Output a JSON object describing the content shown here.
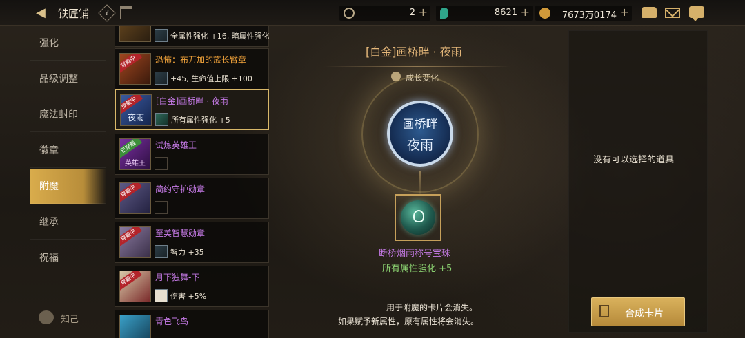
{
  "header": {
    "back_arrow": "chevron-left-icon",
    "title": "铁匠铺",
    "help_glyph": "?",
    "calendar_glyph": "",
    "currencies": [
      {
        "name": "cera-coin-icon",
        "value": "2",
        "plus": "+"
      },
      {
        "name": "green-gem-icon",
        "value": "8621",
        "plus": "+"
      },
      {
        "name": "gold-coin-icon",
        "value": "7673万0174",
        "plus": "+"
      }
    ]
  },
  "menu": {
    "items": [
      "强化",
      "品级调整",
      "魔法封印",
      "徽章",
      "附魔",
      "继承",
      "祝福"
    ],
    "active_index": 4,
    "bottom_label": "知己"
  },
  "items": [
    {
      "name": "",
      "attr": "全属性强化 +16, 暗属性强化"
    },
    {
      "name": "恐怖：布万加的族长臂章",
      "attr": "+45, 生命值上限 +100"
    },
    {
      "name": "[白金]画桥畔 · 夜雨",
      "attr": "所有属性强化 +5"
    },
    {
      "name": "试炼英雄王",
      "attr": ""
    },
    {
      "name": "简约守护勋章",
      "attr": ""
    },
    {
      "name": "至美智慧勋章",
      "attr": "智力 +35"
    },
    {
      "name": "月下独舞-下",
      "attr": "伤害 +5%"
    },
    {
      "name": "青色飞鸟",
      "attr": ""
    }
  ],
  "item_badges": [
    "",
    "穿戴中",
    "穿戴中",
    "已穿戴",
    "穿戴中",
    "穿戴中",
    "穿戴中",
    ""
  ],
  "thumb_text": [
    "",
    "",
    "夜雨",
    "英雄王",
    "",
    "",
    "",
    ""
  ],
  "center": {
    "title": "[白金]画桥畔 · 夜雨",
    "growth_label": "成长变化",
    "emblem_line1": "画桥畔",
    "emblem_line2": "夜雨",
    "gem_name": "断桥烟雨称号宝珠",
    "gem_attr": "所有属性强化 +5",
    "note_line1": "用于附魔的卡片会消失。",
    "note_line2": "如果赋予新属性，原有属性将会消失。"
  },
  "right": {
    "empty_text": "没有可以选择的道具",
    "synth_button": "合成卡片"
  },
  "colors": {
    "accent_gold": "#d9b15c",
    "selected_border": "#d9b86a",
    "orange_name": "#f0a23a",
    "purple_name": "#c77be8",
    "green_attr": "#8ad070"
  }
}
